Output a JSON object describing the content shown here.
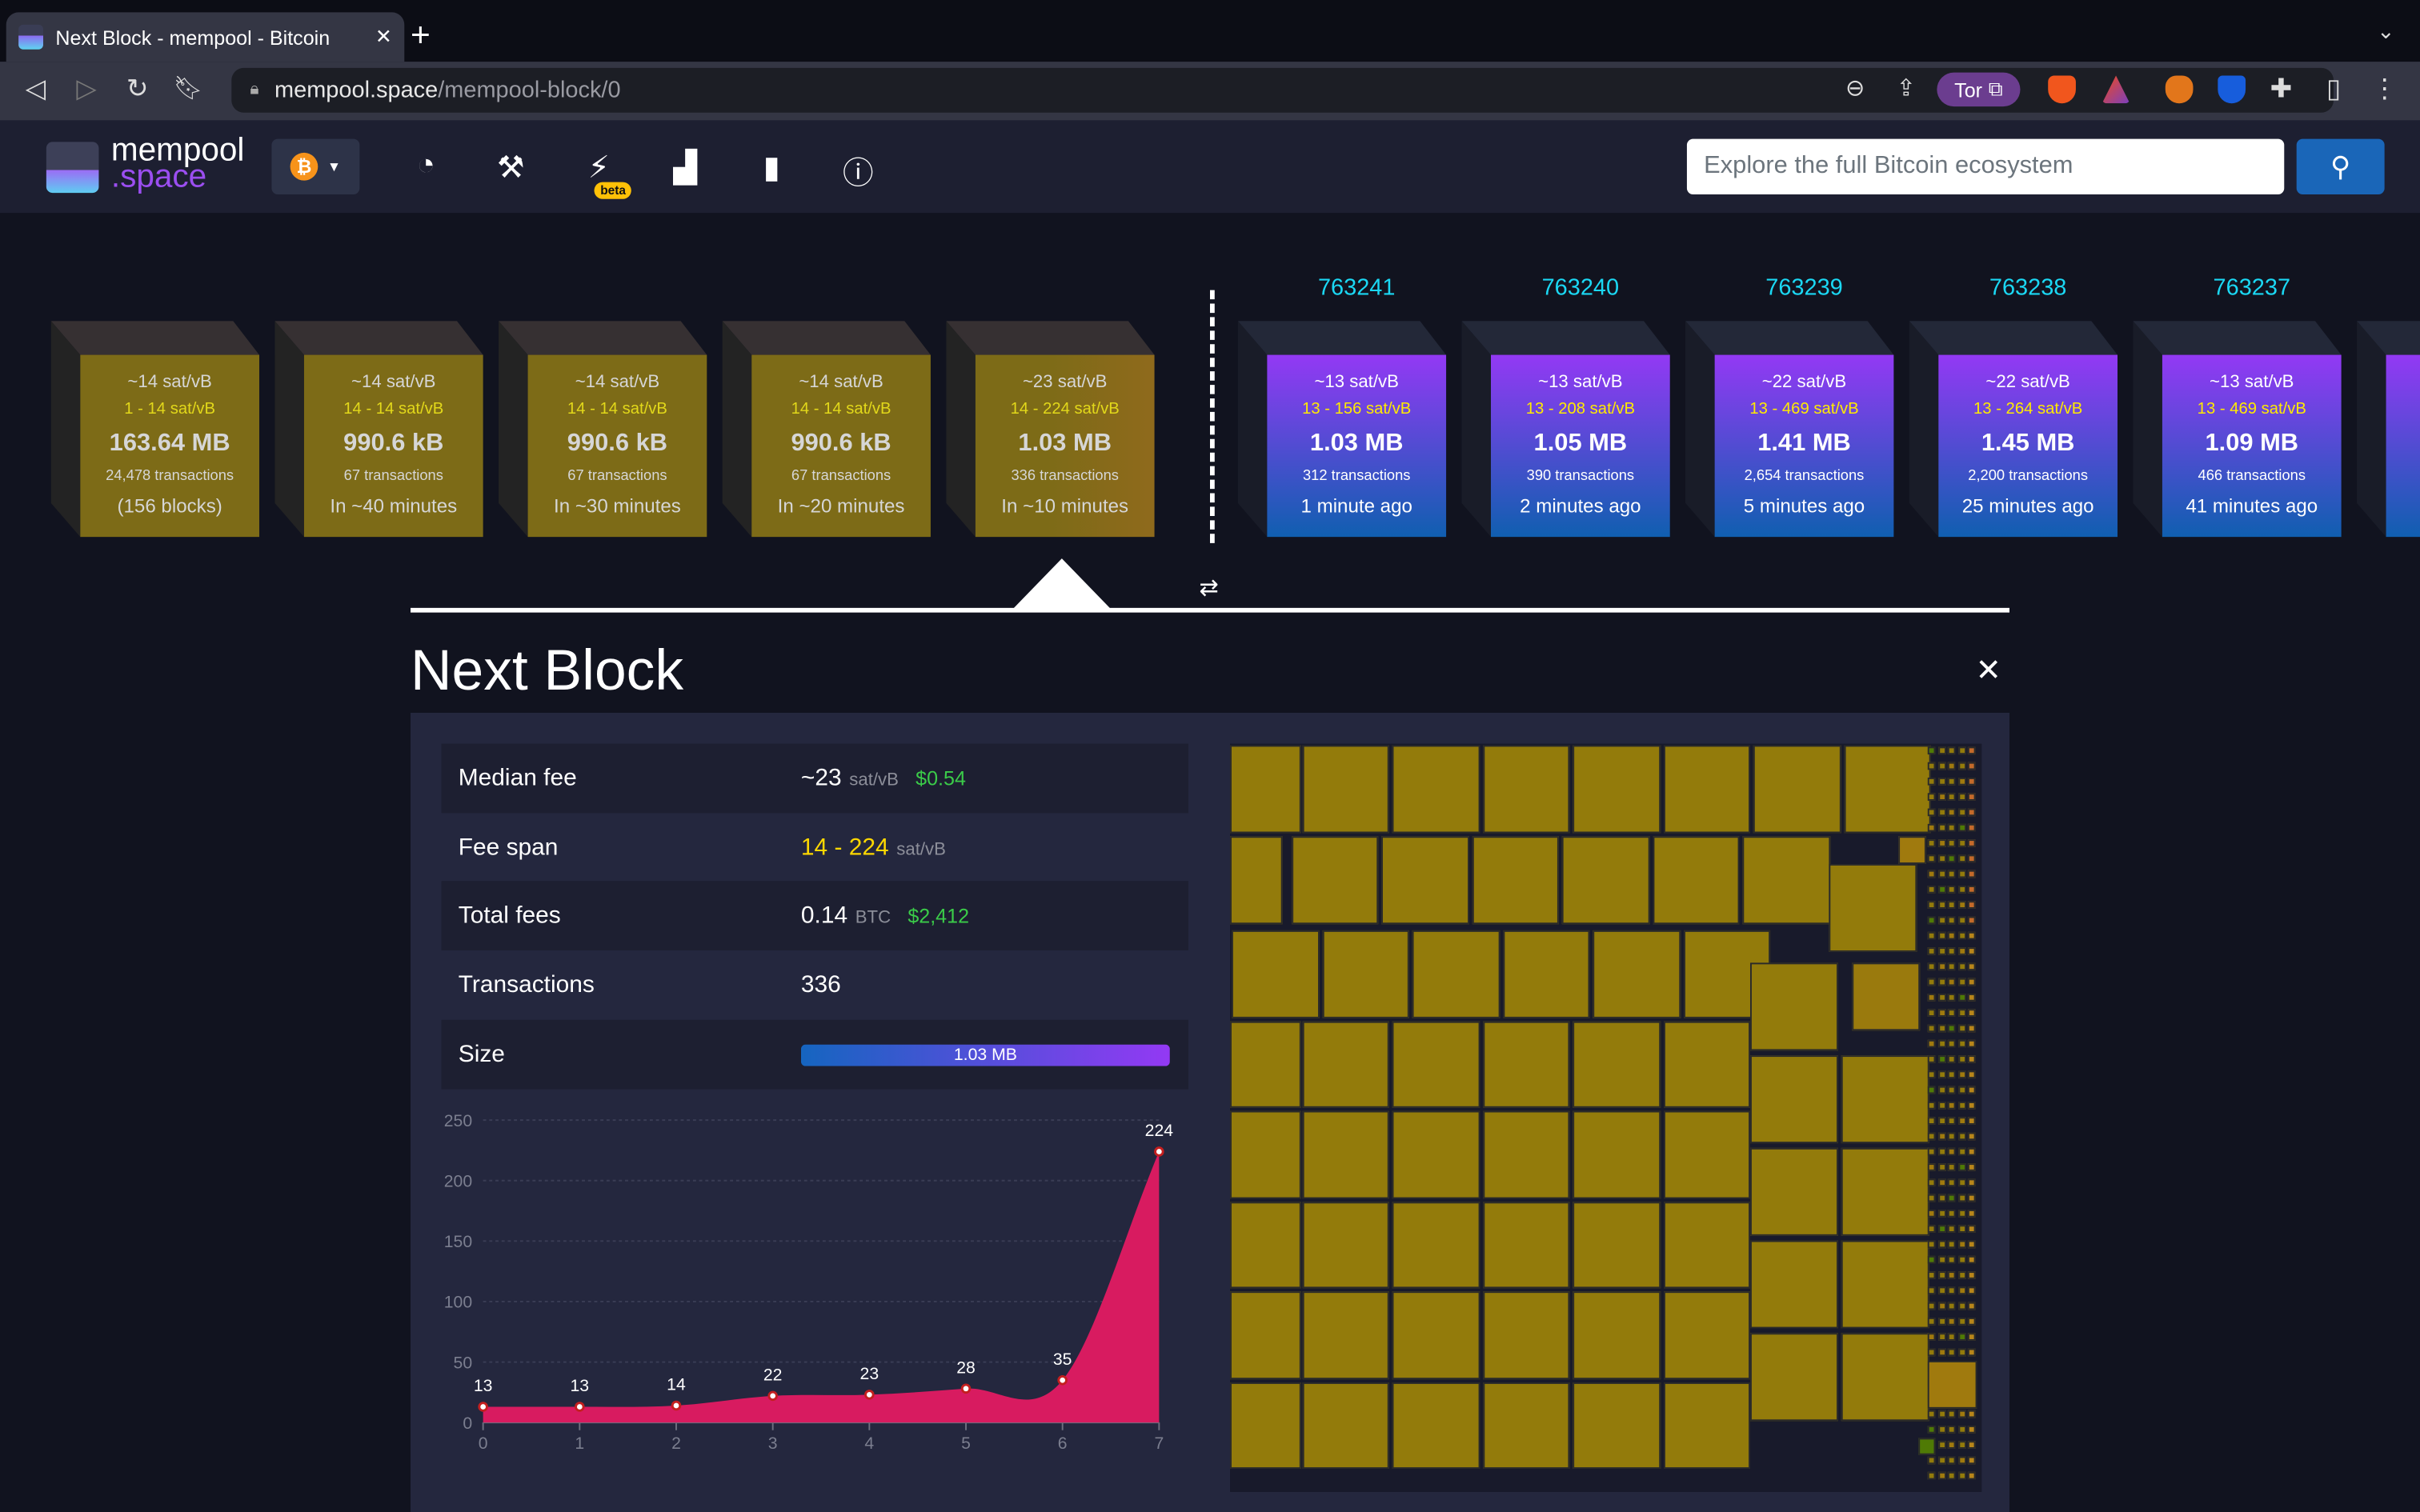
{
  "browser": {
    "tab_title": "Next Block - mempool - Bitcoin",
    "url_host": "mempool.space",
    "url_path": "/mempool-block/0",
    "tor_label": "Tor",
    "icons": [
      "back-icon",
      "forward-icon",
      "reload-icon",
      "bookmark-icon",
      "lock-icon",
      "zoom-out-icon",
      "share-icon",
      "brave-shields-icon",
      "brave-rewards-icon",
      "metamask-icon",
      "bitwarden-icon",
      "extensions-icon",
      "sidebar-icon",
      "menu-icon"
    ]
  },
  "nav": {
    "logo_top": "mempool",
    "logo_bottom": ".space",
    "network": "bitcoin",
    "beta_badge": "beta",
    "icons": [
      "dashboard-icon",
      "mining-icon",
      "lightning-icon",
      "graphs-icon",
      "docs-icon",
      "about-icon"
    ],
    "search_placeholder": "Explore the full Bitcoin ecosystem"
  },
  "mempool_blocks": [
    {
      "median": "~14 sat/vB",
      "range": "1 - 14 sat/vB",
      "size": "163.64 MB",
      "txs": "24,478 transactions",
      "eta": "(156 blocks)"
    },
    {
      "median": "~14 sat/vB",
      "range": "14 - 14 sat/vB",
      "size": "990.6 kB",
      "txs": "67 transactions",
      "eta": "In ~40 minutes"
    },
    {
      "median": "~14 sat/vB",
      "range": "14 - 14 sat/vB",
      "size": "990.6 kB",
      "txs": "67 transactions",
      "eta": "In ~30 minutes"
    },
    {
      "median": "~14 sat/vB",
      "range": "14 - 14 sat/vB",
      "size": "990.6 kB",
      "txs": "67 transactions",
      "eta": "In ~20 minutes"
    },
    {
      "median": "~23 sat/vB",
      "range": "14 - 224 sat/vB",
      "size": "1.03 MB",
      "txs": "336 transactions",
      "eta": "In ~10 minutes"
    }
  ],
  "mined_blocks": [
    {
      "height": "763241",
      "median": "~13 sat/vB",
      "range": "13 - 156 sat/vB",
      "size": "1.03 MB",
      "txs": "312 transactions",
      "age": "1 minute ago"
    },
    {
      "height": "763240",
      "median": "~13 sat/vB",
      "range": "13 - 208 sat/vB",
      "size": "1.05 MB",
      "txs": "390 transactions",
      "age": "2 minutes ago"
    },
    {
      "height": "763239",
      "median": "~22 sat/vB",
      "range": "13 - 469 sat/vB",
      "size": "1.41 MB",
      "txs": "2,654 transactions",
      "age": "5 minutes ago"
    },
    {
      "height": "763238",
      "median": "~22 sat/vB",
      "range": "13 - 264 sat/vB",
      "size": "1.45 MB",
      "txs": "2,200 transactions",
      "age": "25 minutes ago"
    },
    {
      "height": "763237",
      "median": "~13 sat/vB",
      "range": "13 - 469 sat/vB",
      "size": "1.09 MB",
      "txs": "466 transactions",
      "age": "41 minutes ago"
    }
  ],
  "details": {
    "title": "Next Block",
    "median_fee": {
      "label": "Median fee",
      "value": "~23",
      "unit": "sat/vB",
      "fiat": "$0.54"
    },
    "fee_span": {
      "label": "Fee span",
      "value": "14 - 224",
      "unit": "sat/vB"
    },
    "total_fees": {
      "label": "Total fees",
      "value": "0.14",
      "unit": "BTC",
      "fiat": "$2,412"
    },
    "transactions": {
      "label": "Transactions",
      "value": "336"
    },
    "size": {
      "label": "Size",
      "value": "1.03 MB",
      "fill_percent": 100
    }
  },
  "colors": {
    "accent": "#1bd8f4",
    "mempool_block": "#7d6b17",
    "mined_top": "#9339f4",
    "mined_bottom": "#105fb0",
    "chart_fill": "#d81b60",
    "fiat": "#3bcc49",
    "fee_span": "#ffd800",
    "search_button": "#1a66b8"
  },
  "chart_data": {
    "type": "area",
    "x": [
      0,
      1,
      2,
      3,
      4,
      5,
      6,
      7
    ],
    "values": [
      13,
      13,
      14,
      22,
      23,
      28,
      35,
      224
    ],
    "data_labels": [
      "13",
      "13",
      "14",
      "22",
      "23",
      "28",
      "35",
      "224"
    ],
    "ylim": [
      0,
      250
    ],
    "yticks": [
      0,
      50,
      100,
      150,
      200,
      250
    ],
    "xticks": [
      0,
      1,
      2,
      3,
      4,
      5,
      6,
      7
    ],
    "grid": true,
    "smooth": true
  }
}
